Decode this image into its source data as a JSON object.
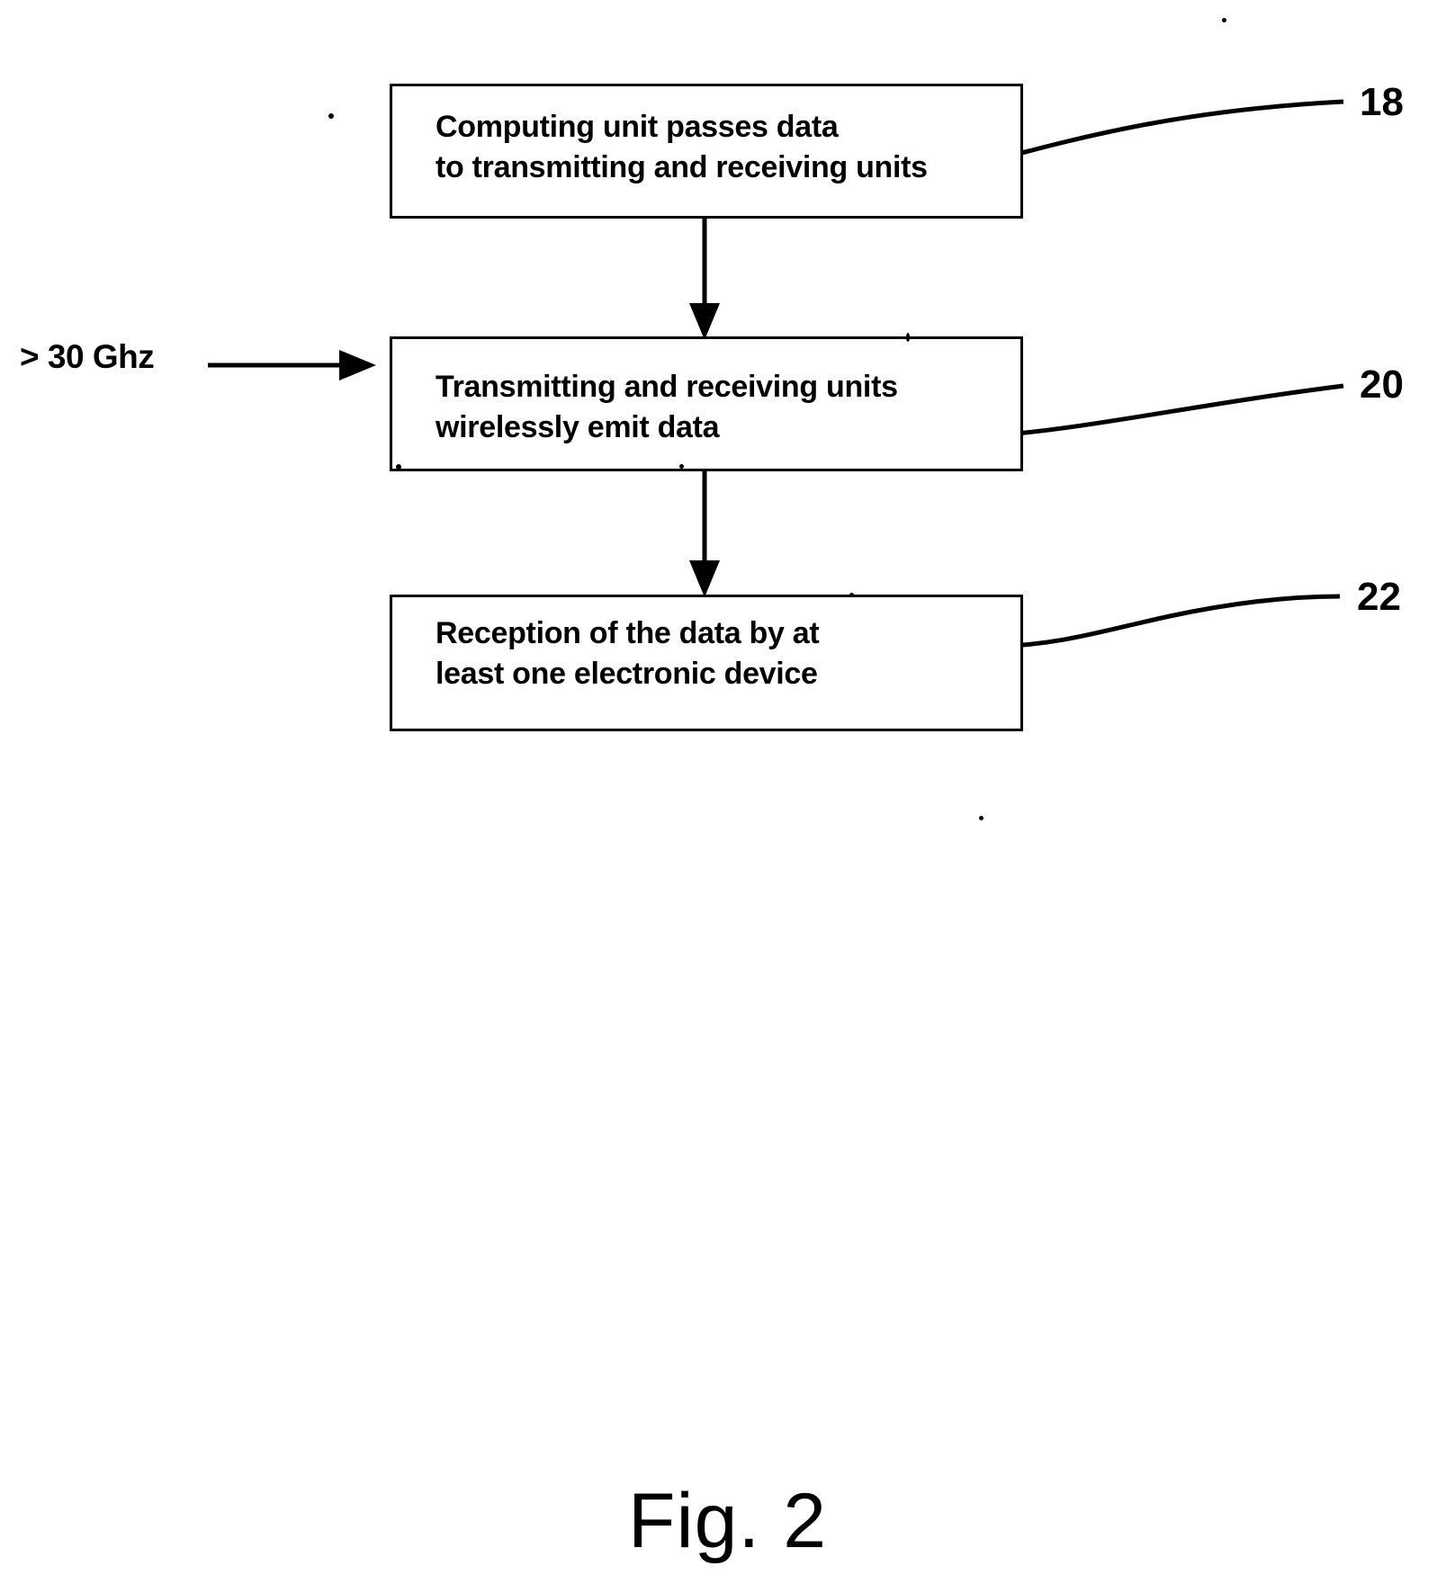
{
  "figure": {
    "caption": "Fig. 2",
    "type": "process-flow-diagram",
    "input_label": "> 30 Ghz",
    "steps": [
      {
        "ref": "18",
        "text": "Computing unit passes data\nto transmitting and receiving units"
      },
      {
        "ref": "20",
        "text": "Transmitting and receiving units\nwirelessly emit data"
      },
      {
        "ref": "22",
        "text": "Reception of the data by at\nleast one electronic device"
      }
    ],
    "reference_numerals": {
      "step_1": "18",
      "step_2": "20",
      "step_3": "22"
    },
    "colors": {
      "ink": "#000000",
      "paper": "#ffffff"
    }
  }
}
